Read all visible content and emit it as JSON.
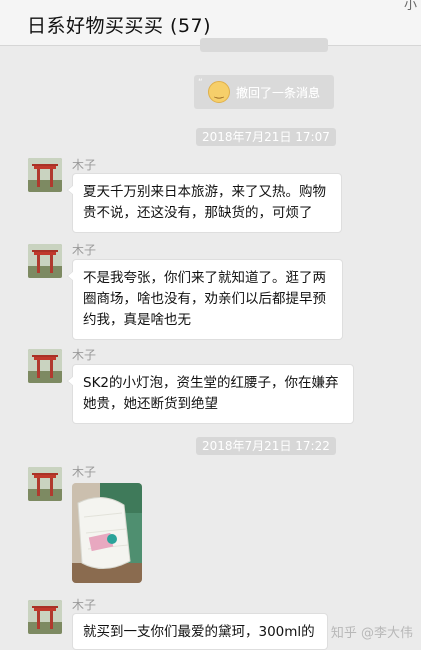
{
  "header": {
    "title": "日系好物买买买 (57)",
    "corner": "小"
  },
  "recall": {
    "text": "撤回了一条消息"
  },
  "timestamps": [
    "2018年7月21日 17:07",
    "2018年7月21日 17:22"
  ],
  "messages": [
    {
      "sender": "木子",
      "text": "夏天千万别来日本旅游，来了又热。购物贵不说，还这没有，那缺货的，可烦了"
    },
    {
      "sender": "木子",
      "text": "不是我夸张，你们来了就知道了。逛了两圈商场，啥也没有，劝亲们以后都提早预约我，真是啥也无"
    },
    {
      "sender": "木子",
      "text": "SK2的小灯泡，资生堂的红腰子，你在嫌弃她贵，她还断货到绝望"
    },
    {
      "sender": "木子",
      "type": "image"
    },
    {
      "sender": "木子",
      "text": "就买到一支你们最爱的黛珂，300ml的"
    }
  ],
  "watermark": "知乎 @李大伟",
  "colors": {
    "background": "#ebebeb",
    "bubble": "#ffffff",
    "timestamp_bg": "#d7d7d7"
  }
}
